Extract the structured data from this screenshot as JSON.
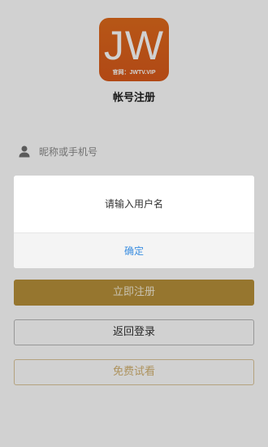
{
  "logo": {
    "text": "JW",
    "subtitle": "官网：JWTV.VIP"
  },
  "page": {
    "title": "帐号注册"
  },
  "username": {
    "placeholder": "昵称或手机号"
  },
  "buttons": {
    "register": "立即注册",
    "back_login": "返回登录",
    "free_trial": "免费试看"
  },
  "dialog": {
    "message": "请输入用户名",
    "confirm": "确定"
  },
  "colors": {
    "logo": "#d8591a",
    "register_button": "#b8913a",
    "confirm_text": "#3a8de0"
  }
}
